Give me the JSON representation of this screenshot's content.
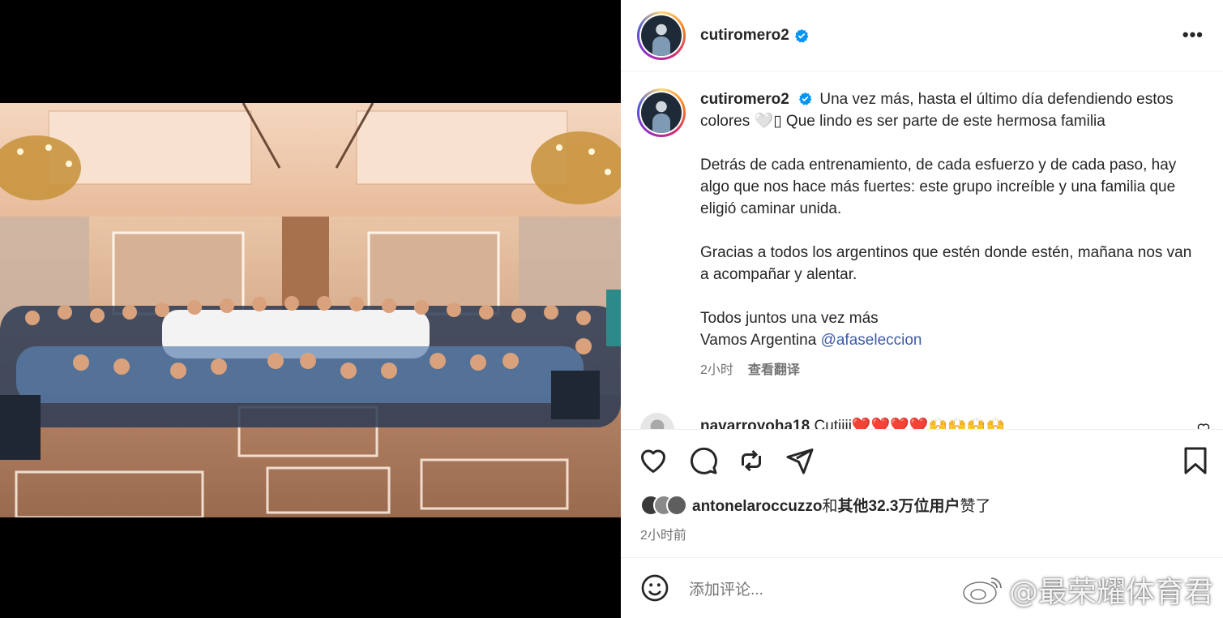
{
  "post": {
    "username": "cutiromero2",
    "caption_lines_1": "Una vez más, hasta el último día defendiendo estos colores 🤍▯ Que lindo es ser parte de este hermosa familia",
    "caption_para_2": "Detrás de cada entrenamiento, de cada esfuerzo y de cada paso, hay algo que nos hace más fuertes: este grupo increíble y una familia que eligió caminar unida.",
    "caption_para_3": "Gracias a todos los argentinos que estén donde estén, mañana nos van a acompañar y alentar.",
    "caption_line_4": "Todos juntos una vez más",
    "caption_line_5_prefix": "Vamos Argentina ",
    "mention": "@afaseleccion",
    "caption_time": "2小时",
    "translate_label": "查看翻译",
    "more_label": "•••"
  },
  "comment": {
    "username": "navarroyoha18",
    "text": "Cutiiii❤️❤️❤️❤️🙌🙌🙌🙌"
  },
  "likes": {
    "first_user": "antonelaroccuzzo",
    "connector": "和",
    "others": "其他32.3万位用户",
    "suffix": "赞了"
  },
  "posted_time": "2小时前",
  "comment_input": {
    "placeholder": "添加评论..."
  },
  "watermark": "@最荣耀体育君",
  "colors": {
    "verified": "#0095f6",
    "mention": "#3b5ba9",
    "secondary_text": "#737373"
  }
}
